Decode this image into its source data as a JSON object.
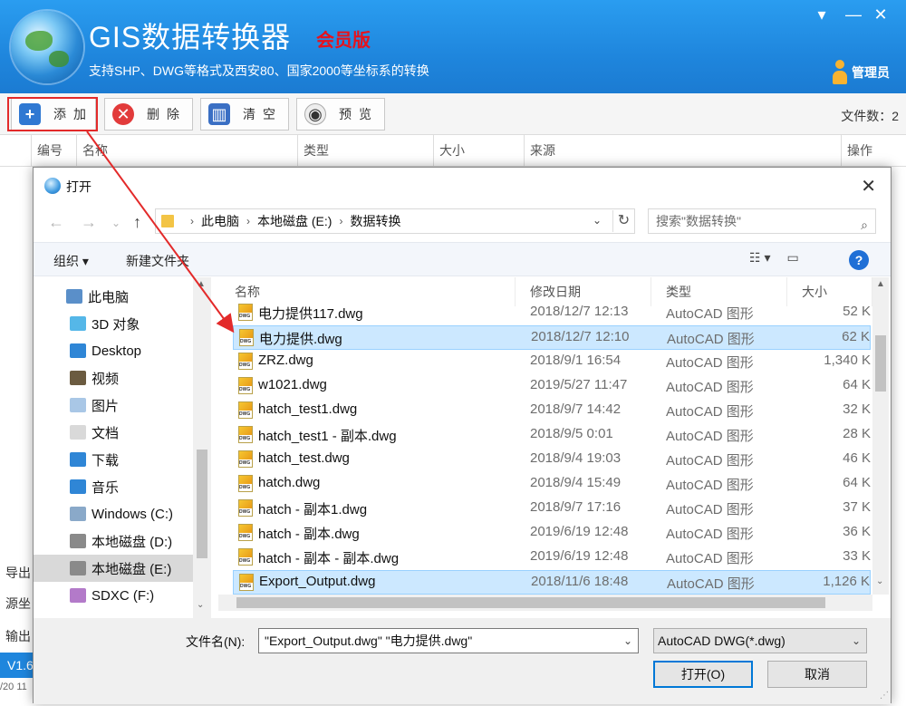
{
  "app": {
    "title": "GIS数据转换器",
    "badge": "会员版",
    "subtitle": "支持SHP、DWG等格式及西安80、国家2000等坐标系的转换",
    "admin_label": "管理员",
    "win_menu": "▾",
    "win_min": "—",
    "win_close": "✕"
  },
  "toolbar": {
    "add_label": "添加",
    "delete_label": "删除",
    "clear_label": "清空",
    "preview_label": "预览",
    "file_count": "文件数：2"
  },
  "grid_headers": [
    "编号",
    "名称",
    "类型",
    "大小",
    "来源",
    "操作"
  ],
  "left_labels": [
    "导出",
    "源坐",
    "输出"
  ],
  "status": {
    "version": "V1.6",
    "date_fragment": "/20 11"
  },
  "dialog": {
    "title": "打开",
    "address": [
      "此电脑",
      "本地磁盘 (E:)",
      "数据转换"
    ],
    "search_placeholder": "搜索\"数据转换\"",
    "organize": "组织 ▾",
    "new_folder": "新建文件夹",
    "nav_items": [
      {
        "label": "此电脑",
        "color": "#5a8fc9"
      },
      {
        "label": "3D 对象",
        "color": "#55b7e8"
      },
      {
        "label": "Desktop",
        "color": "#2f86d6"
      },
      {
        "label": "视频",
        "color": "#6b5b40"
      },
      {
        "label": "图片",
        "color": "#a9c7e6"
      },
      {
        "label": "文档",
        "color": "#d9d9d9"
      },
      {
        "label": "下载",
        "color": "#2f86d6"
      },
      {
        "label": "音乐",
        "color": "#2f86d6"
      },
      {
        "label": "Windows (C:)",
        "color": "#8aa9c9"
      },
      {
        "label": "本地磁盘 (D:)",
        "color": "#8a8a8a"
      },
      {
        "label": "本地磁盘 (E:)",
        "color": "#8a8a8a"
      },
      {
        "label": "SDXC (F:)",
        "color": "#b37ac9"
      }
    ],
    "columns": {
      "name": "名称",
      "date": "修改日期",
      "type": "类型",
      "size": "大小"
    },
    "files": [
      {
        "name": "电力提供117.dwg",
        "date": "2018/12/7 12:13",
        "type": "AutoCAD 图形",
        "size": "52 K"
      },
      {
        "name": "电力提供.dwg",
        "date": "2018/12/7 12:10",
        "type": "AutoCAD 图形",
        "size": "62 K"
      },
      {
        "name": "ZRZ.dwg",
        "date": "2018/9/1 16:54",
        "type": "AutoCAD 图形",
        "size": "1,340 K"
      },
      {
        "name": "w1021.dwg",
        "date": "2019/5/27 11:47",
        "type": "AutoCAD 图形",
        "size": "64 K"
      },
      {
        "name": "hatch_test1.dwg",
        "date": "2018/9/7 14:42",
        "type": "AutoCAD 图形",
        "size": "32 K"
      },
      {
        "name": "hatch_test1 - 副本.dwg",
        "date": "2018/9/5 0:01",
        "type": "AutoCAD 图形",
        "size": "28 K"
      },
      {
        "name": "hatch_test.dwg",
        "date": "2018/9/4 19:03",
        "type": "AutoCAD 图形",
        "size": "46 K"
      },
      {
        "name": "hatch.dwg",
        "date": "2018/9/4 15:49",
        "type": "AutoCAD 图形",
        "size": "64 K"
      },
      {
        "name": "hatch - 副本1.dwg",
        "date": "2018/9/7 17:16",
        "type": "AutoCAD 图形",
        "size": "37 K"
      },
      {
        "name": "hatch - 副本.dwg",
        "date": "2019/6/19 12:48",
        "type": "AutoCAD 图形",
        "size": "36 K"
      },
      {
        "name": "hatch - 副本 - 副本.dwg",
        "date": "2019/6/19 12:48",
        "type": "AutoCAD 图形",
        "size": "33 K"
      },
      {
        "name": "Export_Output.dwg",
        "date": "2018/11/6 18:48",
        "type": "AutoCAD 图形",
        "size": "1,126 K"
      }
    ],
    "selected_files": [
      "电力提供.dwg",
      "Export_Output.dwg"
    ],
    "filename_label": "文件名(N):",
    "filename_value": "\"Export_Output.dwg\" \"电力提供.dwg\"",
    "filter_value": "AutoCAD DWG(*.dwg)",
    "open_button": "打开(O)",
    "cancel_button": "取消"
  },
  "colors": {
    "header_blue": "#1f86dd",
    "badge_red": "#e8121b",
    "highlight_red": "#e32a2a",
    "selection_blue": "#cce8ff"
  }
}
